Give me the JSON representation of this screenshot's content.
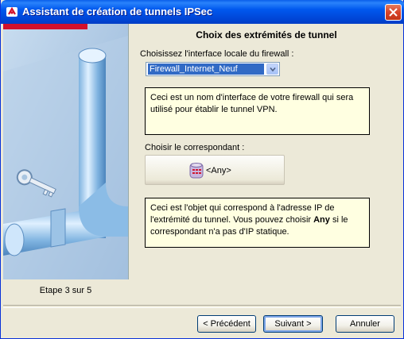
{
  "window": {
    "title": "Assistant de création de tunnels IPSec"
  },
  "left_pane": {
    "step_label": "Etape 3 sur 5"
  },
  "main": {
    "section_title": "Choix des extrémités de tunnel",
    "interface_label": "Choisissez l'interface locale du firewall :",
    "interface_select": {
      "selected_value": "Firewall_Internet_Neuf"
    },
    "info_interface": "Ceci est un nom d'interface de votre firewall qui sera utilisé pour établir le tunnel VPN.",
    "correspondent_label": "Choisir le correspondant :",
    "correspondent_button": {
      "label": "<Any>",
      "icon": "network-object-icon"
    },
    "info_correspondent": {
      "part1": "Ceci est l'objet qui correspond à l'adresse IP de l'extrémité du tunnel. Vous pouvez choisir ",
      "bold": "Any",
      "part2": " si le correspondant n'a pas d'IP statique."
    }
  },
  "footer": {
    "prev_label": "< Précédent",
    "next_label": "Suivant >",
    "cancel_label": "Annuler"
  },
  "colors": {
    "titlebar": "#0058ee",
    "accent_red": "#d2102c",
    "info_bg": "#ffffe1",
    "selection": "#316ac5"
  }
}
